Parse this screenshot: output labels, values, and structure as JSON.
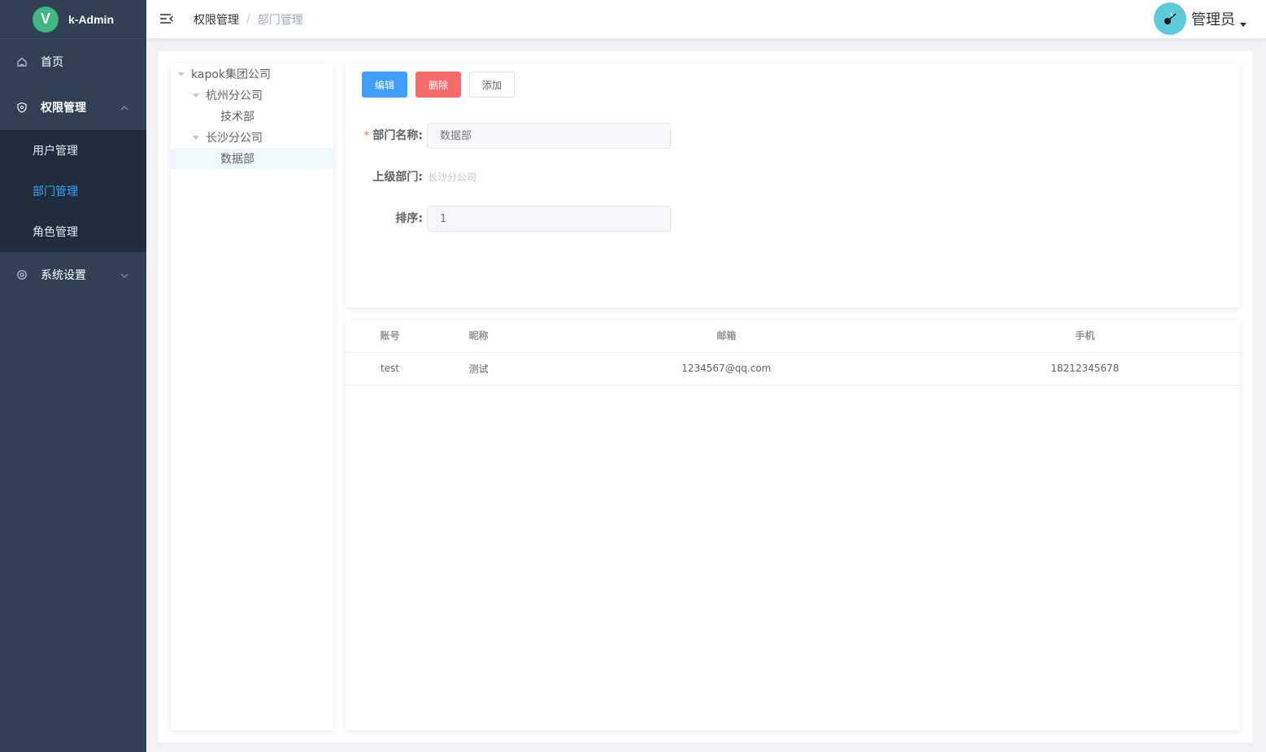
{
  "app": {
    "logo_letter": "V",
    "name": "k-Admin"
  },
  "sidebar": {
    "items": [
      {
        "label": "首页",
        "icon": "home-icon"
      },
      {
        "label": "权限管理",
        "icon": "shield-icon",
        "expanded": true,
        "children": [
          {
            "label": "用户管理"
          },
          {
            "label": "部门管理",
            "active": true
          },
          {
            "label": "角色管理"
          }
        ]
      },
      {
        "label": "系统设置",
        "icon": "settings-icon",
        "expanded": false
      }
    ]
  },
  "header": {
    "breadcrumb": [
      "权限管理",
      "部门管理"
    ],
    "breadcrumb_separator": "/",
    "user_name": "管理员"
  },
  "tree": {
    "nodes": [
      {
        "label": "kapok集团公司",
        "level": 0,
        "expanded": true
      },
      {
        "label": "杭州分公司",
        "level": 1,
        "expanded": true
      },
      {
        "label": "技术部",
        "level": 2
      },
      {
        "label": "长沙分公司",
        "level": 1,
        "expanded": true
      },
      {
        "label": "数据部",
        "level": 2,
        "current": true
      }
    ]
  },
  "toolbar": {
    "edit_label": "编辑",
    "delete_label": "删除",
    "add_label": "添加"
  },
  "form": {
    "name_label": "部门名称:",
    "name_placeholder": "数据部",
    "parent_label": "上级部门:",
    "parent_value": "长沙分公司",
    "sort_label": "排序:",
    "sort_placeholder": "1"
  },
  "table": {
    "columns": [
      "账号",
      "昵称",
      "邮箱",
      "手机"
    ],
    "rows": [
      [
        "test",
        "测试",
        "1234567@qq.com",
        "18212345678"
      ]
    ]
  },
  "colors": {
    "sidebar_bg": "#304156",
    "submenu_bg": "#1f2d3d",
    "primary": "#409eff",
    "danger": "#f56c6c",
    "logo": "#41b883"
  }
}
